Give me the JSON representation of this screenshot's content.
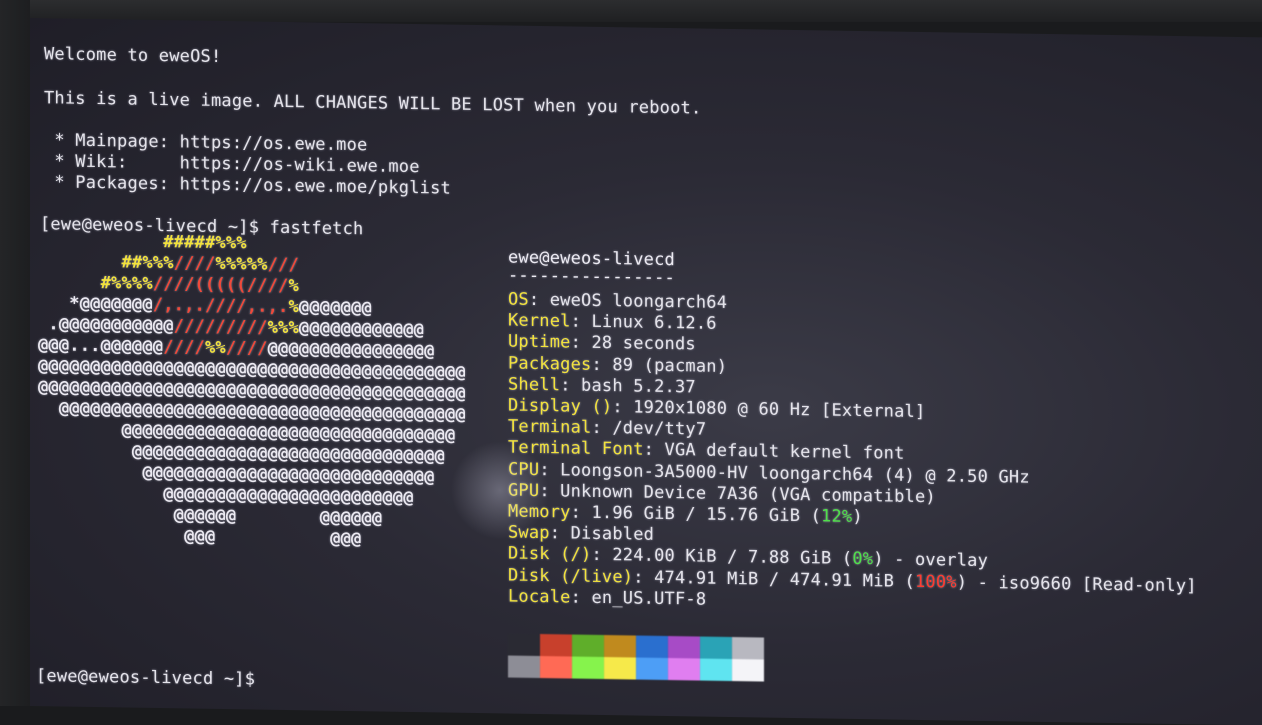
{
  "terminal": {
    "welcome": "Welcome to eweOS!",
    "live_notice": "This is a live image. ALL CHANGES WILL BE LOST when you reboot.",
    "links": [
      {
        "label": " * Mainpage: ",
        "url": "https://os.ewe.moe"
      },
      {
        "label": " * Wiki:     ",
        "url": "https://os-wiki.ewe.moe"
      },
      {
        "label": " * Packages: ",
        "url": "https://os.ewe.moe/pkglist"
      }
    ],
    "prompt": "[ewe@eweos-livecd ~]$ ",
    "command": "fastfetch",
    "final_prompt": "[ewe@eweos-livecd ~]$"
  },
  "fastfetch": {
    "user_host": "ewe@eweos-livecd",
    "separator": "----------------",
    "rows": [
      {
        "key": "OS",
        "value": ": eweOS loongarch64"
      },
      {
        "key": "Kernel",
        "value": ": Linux 6.12.6"
      },
      {
        "key": "Uptime",
        "value": ": 28 seconds"
      },
      {
        "key": "Packages",
        "value": ": 89 (pacman)"
      },
      {
        "key": "Shell",
        "value": ": bash 5.2.37"
      },
      {
        "key": "Display ()",
        "value": ": 1920x1080 @ 60 Hz [External]"
      },
      {
        "key": "Terminal",
        "value": ": /dev/tty7"
      },
      {
        "key": "Terminal Font",
        "value": ": VGA default kernel font"
      },
      {
        "key": "CPU",
        "value": ": Loongson-3A5000-HV loongarch64 (4) @ 2.50 GHz"
      },
      {
        "key": "GPU",
        "value": ": Unknown Device 7A36 (VGA compatible)"
      },
      {
        "key": "Memory",
        "value_pre": ": 1.96 GiB / 15.76 GiB (",
        "value_pct": "12%",
        "value_post": ")",
        "pct_color": "green"
      },
      {
        "key": "Swap",
        "value": ": Disabled"
      },
      {
        "key": "Disk (/)",
        "value_pre": ": 224.00 KiB / 7.88 GiB (",
        "value_pct": "0%",
        "value_post": ") - overlay",
        "pct_color": "green"
      },
      {
        "key": "Disk (/live)",
        "value_pre": ": 474.91 MiB / 474.91 MiB (",
        "value_pct": "100%",
        "value_post": ") - iso9660 [Read-only]",
        "pct_color": "red"
      },
      {
        "key": "Locale",
        "value": ": en_US.UTF-8"
      }
    ]
  },
  "logo": {
    "lines": [
      [
        [
          "y",
          "            #####%%%"
        ]
      ],
      [
        [
          "y",
          "        ##%%%"
        ],
        [
          "r",
          "////"
        ],
        [
          "y",
          "%%%%%"
        ],
        [
          "r",
          "///"
        ]
      ],
      [
        [
          "y",
          "      #%%%%"
        ],
        [
          "r",
          "////(((((////"
        ],
        [
          "y",
          "%"
        ]
      ],
      [
        [
          "w",
          "   *@@@@@@@"
        ],
        [
          "r",
          "/,.,.////,.,."
        ],
        [
          "y",
          "%"
        ],
        [
          "w",
          "@@@@@@@"
        ]
      ],
      [
        [
          "w",
          " .@@@@@@@@@@@"
        ],
        [
          "r",
          "/////////"
        ],
        [
          "y",
          "%%%"
        ],
        [
          "w",
          "@@@@@@@@@@@@"
        ]
      ],
      [
        [
          "w",
          "@@@...@@@@@@"
        ],
        [
          "r",
          "////"
        ],
        [
          "y",
          "%%"
        ],
        [
          "r",
          "////"
        ],
        [
          "w",
          "@@@@@@@@@@@@@@@@"
        ]
      ],
      [
        [
          "w",
          "@@@@@@@@@@@@@@@@@@@@@@@@@@@@@@@@@@@@@@@@@"
        ]
      ],
      [
        [
          "w",
          "@@@@@@@@@@@@@@@@@@@@@@@@@@@@@@@@@@@@@@@@@"
        ]
      ],
      [
        [
          "w",
          "  @@@@@@@@@@@@@@@@@@@@@@@@@@@@@@@@@@@@@@@"
        ]
      ],
      [
        [
          "w",
          "        @@@@@@@@@@@@@@@@@@@@@@@@@@@@@@@@"
        ]
      ],
      [
        [
          "w",
          "         @@@@@@@@@@@@@@@@@@@@@@@@@@@@@@"
        ]
      ],
      [
        [
          "w",
          "          @@@@@@@@@@@@@@@@@@@@@@@@@@@@"
        ]
      ],
      [
        [
          "w",
          "            @@@@@@@@@@@@@@@@@@@@@@@@"
        ]
      ],
      [
        [
          "w",
          "             @@@@@@        @@@@@@"
        ]
      ],
      [
        [
          "w",
          "              @@@           @@@"
        ]
      ]
    ]
  },
  "palette": {
    "top": [
      "#2a2a33",
      "#c8402c",
      "#5fae2a",
      "#c08a1e",
      "#2a6fcf",
      "#a74bc6",
      "#2aa3b6",
      "#b8b8c0"
    ],
    "bottom": [
      "#8d8d96",
      "#ff6a55",
      "#86f34c",
      "#f6e94a",
      "#4d9ef6",
      "#e07ef0",
      "#5fe4f0",
      "#f4f4f8"
    ]
  }
}
